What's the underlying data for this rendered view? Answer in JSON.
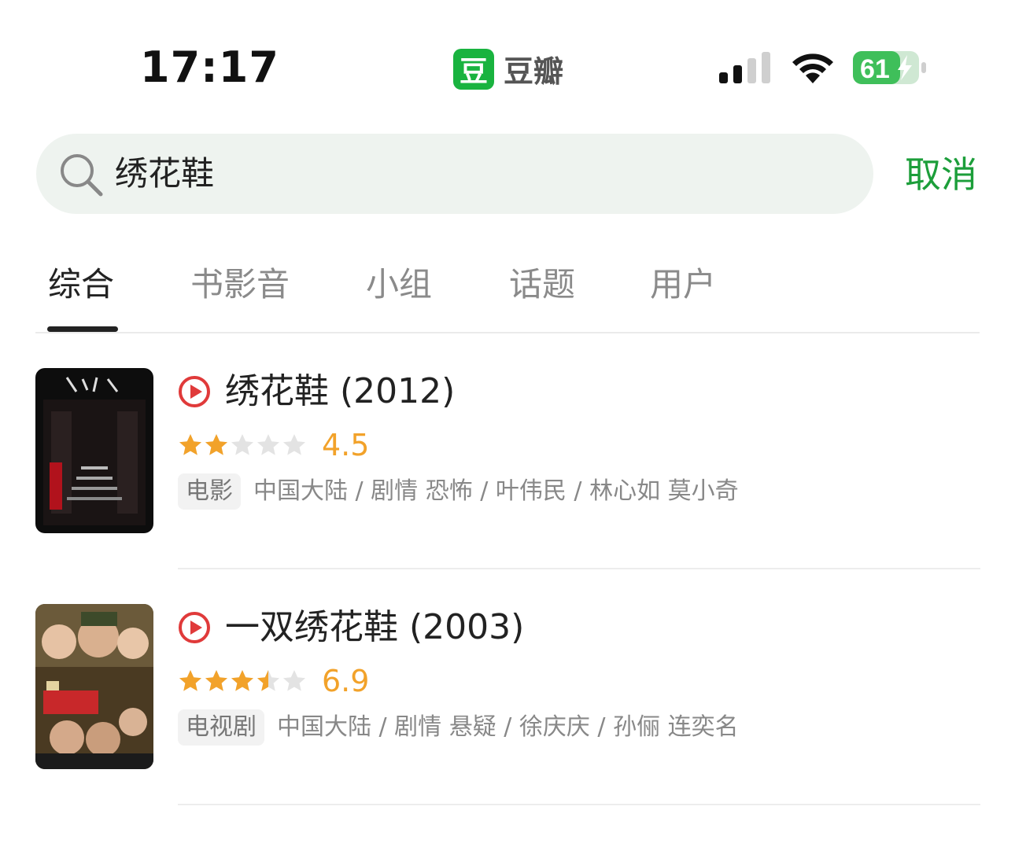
{
  "status_bar": {
    "time": "17:17",
    "app_logo": "豆",
    "app_name": "豆瓣",
    "battery": "61"
  },
  "search": {
    "query": "绣花鞋",
    "cancel_label": "取消"
  },
  "tabs": [
    {
      "label": "综合",
      "active": true
    },
    {
      "label": "书影音",
      "active": false
    },
    {
      "label": "小组",
      "active": false
    },
    {
      "label": "话题",
      "active": false
    },
    {
      "label": "用户",
      "active": false
    }
  ],
  "results": [
    {
      "title": "绣花鞋 (2012)",
      "rating": 4.5,
      "score": "4.5",
      "stars": 2,
      "type": "电影",
      "meta": "中国大陆 / 剧情 恐怖 / 叶伟民 / 林心如 莫小奇"
    },
    {
      "title": "一双绣花鞋 (2003)",
      "rating": 6.9,
      "score": "6.9",
      "stars": 3.5,
      "type": "电视剧",
      "meta": "中国大陆 / 剧情 悬疑 / 徐庆庆 / 孙俪 连奕名"
    }
  ],
  "colors": {
    "accent_green": "#1c9e3a",
    "star_gold": "#f2a22a",
    "play_red": "#e03a3a"
  }
}
